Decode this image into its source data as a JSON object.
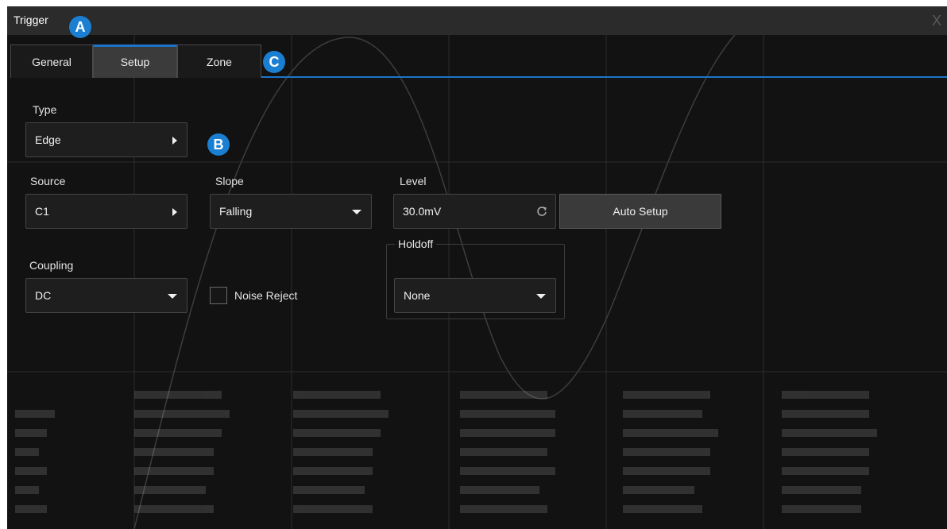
{
  "window": {
    "title": "Trigger",
    "close_label": "X"
  },
  "annotations": {
    "a": "A",
    "b": "B",
    "c": "C"
  },
  "tabs": [
    {
      "label": "General",
      "active": false
    },
    {
      "label": "Setup",
      "active": true
    },
    {
      "label": "Zone",
      "active": false
    }
  ],
  "type": {
    "label": "Type",
    "value": "Edge"
  },
  "source": {
    "label": "Source",
    "value": "C1"
  },
  "slope": {
    "label": "Slope",
    "value": "Falling"
  },
  "level": {
    "label": "Level",
    "value": "30.0mV"
  },
  "auto_setup": {
    "label": "Auto Setup"
  },
  "coupling": {
    "label": "Coupling",
    "value": "DC"
  },
  "noise_reject": {
    "label": "Noise Reject",
    "checked": false
  },
  "holdoff": {
    "label": "Holdoff",
    "value": "None"
  },
  "colors": {
    "accent": "#1d74c8",
    "badge": "#1b7fd1",
    "background": "#121212",
    "title_bar": "#2b2b2b"
  },
  "icons": {
    "type_arrow": "arrow-right-icon",
    "source_arrow": "arrow-right-icon",
    "slope_arrow": "chevron-down-icon",
    "level_spin": "refresh-icon",
    "coupling_arrow": "chevron-down-icon",
    "holdoff_arrow": "chevron-down-icon",
    "close": "close-icon"
  }
}
